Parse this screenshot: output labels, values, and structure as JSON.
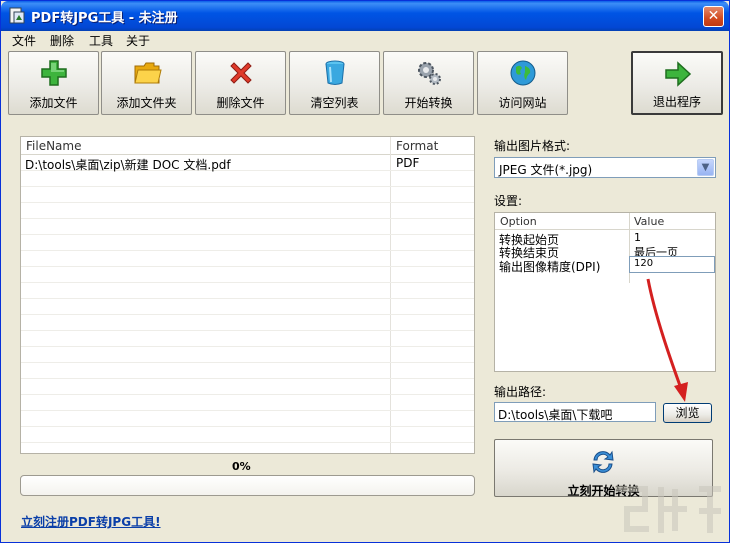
{
  "window": {
    "title": "PDF转JPG工具 - 未注册",
    "close_label": "✕"
  },
  "menu": [
    "文件",
    "删除",
    "工具",
    "关于"
  ],
  "toolbar": {
    "add_file": "添加文件",
    "add_folder": "添加文件夹",
    "delete_file": "删除文件",
    "clear_list": "清空列表",
    "start_convert": "开始转换",
    "visit_site": "访问网站",
    "exit": "退出程序"
  },
  "filelist": {
    "col_name": "FileName",
    "col_format": "Format",
    "rows": [
      {
        "name": "D:\\tools\\桌面\\zip\\新建 DOC 文档.pdf",
        "format": "PDF"
      }
    ]
  },
  "progress": {
    "label": "0%",
    "value": 0
  },
  "register_link": "立刻注册PDF转JPG工具!",
  "output_format": {
    "label": "输出图片格式:",
    "value": "JPEG 文件(*.jpg)"
  },
  "settings": {
    "label": "设置:",
    "col_option": "Option",
    "col_value": "Value",
    "rows": [
      {
        "option": "转换起始页",
        "value": "1"
      },
      {
        "option": "转换结束页",
        "value": "最后一页"
      },
      {
        "option": "输出图像精度(DPI)",
        "value": "120"
      }
    ]
  },
  "output_path": {
    "label": "输出路径:",
    "value": "D:\\tools\\桌面\\下载吧",
    "browse_label": "浏览"
  },
  "start_now": "立刻开始转换",
  "colors": {
    "titlebar": "#0055e5",
    "annotation_arrow": "#d42020",
    "link": "#0b3fa8"
  }
}
